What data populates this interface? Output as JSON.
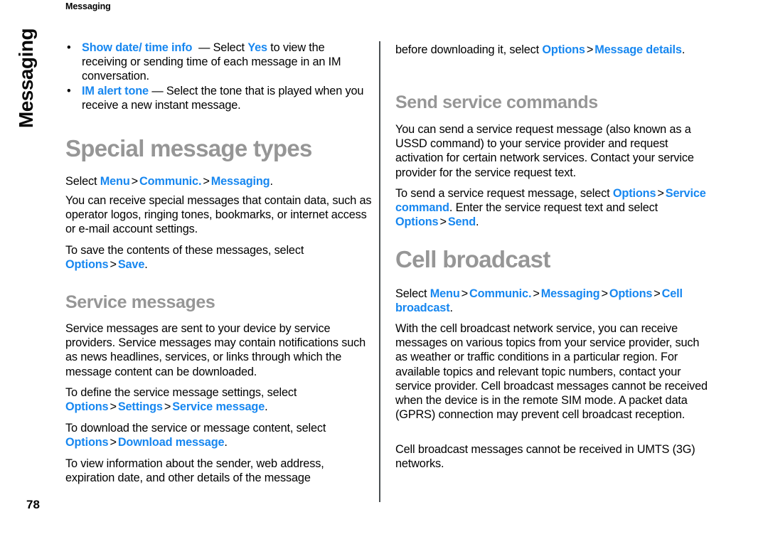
{
  "page": {
    "running_header": "Messaging",
    "chapter_tab": "Messaging",
    "folio": "78",
    "accent_color": "#1787f0",
    "heading_color": "#969696",
    "divider_color": "#4a4f52"
  },
  "left_column": {
    "bullets": [
      {
        "marker": "•",
        "term": "Show date/ time info",
        "dash": "—",
        "rest": " Select ",
        "value": "Yes",
        "tail": " to view the receiving or sending time of each message in an IM conversation."
      },
      {
        "marker": "•",
        "term": "IM alert tone",
        "dash": "—",
        "rest": " Select the tone that is played when you receive a new instant message.",
        "value": "",
        "tail": ""
      }
    ],
    "heading": "Special message types",
    "path_1": {
      "lead": "Select ",
      "items": [
        "Menu",
        "Communic.",
        "Messaging"
      ],
      "separator": ">",
      "period": "."
    },
    "para_1": "You can receive special messages that contain data, such as operator logos, ringing tones, bookmarks, or internet access or e-mail account settings.",
    "para_2": {
      "lead": "To save the contents of these messages, select ",
      "items": [
        "Options",
        "Save"
      ],
      "separator": ">",
      "period": "."
    },
    "subheading": "Service messages",
    "para_3": "Service messages are sent to your device by service providers. Service messages may contain notifications such as news headlines, services, or links through which the message content can be downloaded.",
    "para_4": {
      "lead": "To define the service message settings, select ",
      "items": [
        "Options",
        "Settings",
        "Service message"
      ],
      "separator": ">",
      "period": "."
    },
    "para_5": {
      "lead": "To download the service or message content, select ",
      "items": [
        "Options",
        "Download message"
      ],
      "separator": ">",
      "period": "."
    },
    "para_6": "To view information about the sender, web address, expiration date, and other details of the message"
  },
  "right_column": {
    "para_cont": {
      "lead": "before downloading it, select ",
      "items": [
        "Options",
        "Message details"
      ],
      "separator": ">",
      "period": "."
    },
    "subheading_1": "Send service commands",
    "para_1": "You can send a service request message (also known as a USSD command) to your service provider and request activation for certain network services. Contact your service provider for the service request text.",
    "para_2": {
      "lead": "To send a service request message, select ",
      "items": [
        "Options",
        "Service command"
      ],
      "separator": ">",
      "mid": ". Enter the service request text and select ",
      "items2": [
        "Options",
        "Send"
      ],
      "period": "."
    },
    "heading": "Cell broadcast",
    "path_1": {
      "lead": "Select ",
      "items": [
        "Menu",
        "Communic.",
        "Messaging",
        "Options",
        "Cell broadcast"
      ],
      "separator": ">",
      "period": "."
    },
    "para_3": "With the cell broadcast network service, you can receive messages on various topics from your service provider, such as weather or traffic conditions in a particular region. For available topics and relevant topic numbers, contact your service provider. Cell broadcast messages cannot be received when the device is in the remote SIM mode. A packet data (GPRS) connection may prevent cell broadcast reception.",
    "para_4": "Cell broadcast messages cannot be received in UMTS (3G) networks."
  }
}
